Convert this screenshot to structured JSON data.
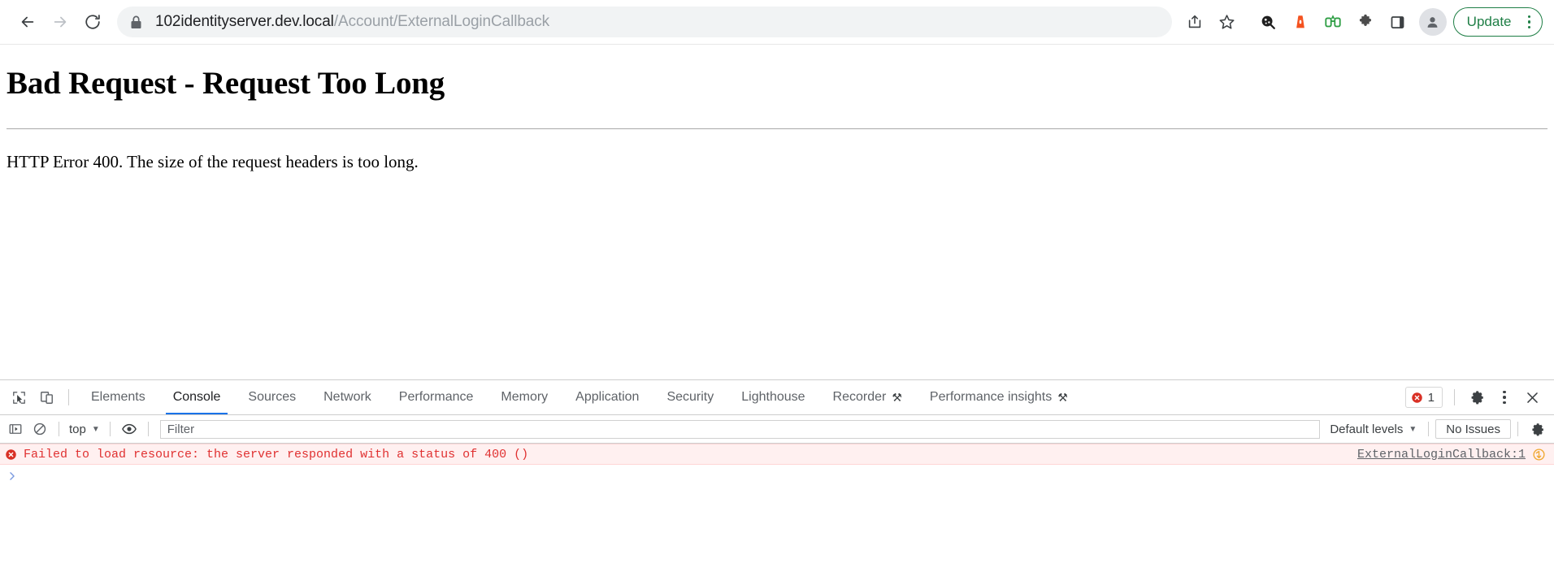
{
  "browser": {
    "back_label": "Back",
    "forward_label": "Forward",
    "reload_label": "Reload",
    "lock_label": "View site information",
    "url_domain": "102identityserver.dev.local",
    "url_path": "/Account/ExternalLoginCallback",
    "share_label": "Share this page",
    "bookmark_label": "Bookmark this tab",
    "extensions": [
      {
        "name": "extension-icon-cookie-editor",
        "color": "#1f1f1f"
      },
      {
        "name": "extension-icon-lighthouse",
        "color": "#f4511e"
      },
      {
        "name": "extension-icon-binoculars",
        "color": "#2e9e44"
      },
      {
        "name": "extensions-puzzle-icon",
        "color": "#4b4b4b"
      }
    ],
    "side_panel_label": "Side panel",
    "profile_label": "Profile",
    "update_label": "Update",
    "menu_label": "Customize and control Google Chrome"
  },
  "page": {
    "title": "Bad Request - Request Too Long",
    "body": "HTTP Error 400. The size of the request headers is too long."
  },
  "devtools": {
    "inspect_label": "Inspect element",
    "device_toggle_label": "Toggle device toolbar",
    "tabs": [
      {
        "label": "Elements",
        "active": false,
        "experimental": false
      },
      {
        "label": "Console",
        "active": true,
        "experimental": false
      },
      {
        "label": "Sources",
        "active": false,
        "experimental": false
      },
      {
        "label": "Network",
        "active": false,
        "experimental": false
      },
      {
        "label": "Performance",
        "active": false,
        "experimental": false
      },
      {
        "label": "Memory",
        "active": false,
        "experimental": false
      },
      {
        "label": "Application",
        "active": false,
        "experimental": false
      },
      {
        "label": "Security",
        "active": false,
        "experimental": false
      },
      {
        "label": "Lighthouse",
        "active": false,
        "experimental": false
      },
      {
        "label": "Recorder",
        "active": false,
        "experimental": true
      },
      {
        "label": "Performance insights",
        "active": false,
        "experimental": true
      }
    ],
    "error_count": "1",
    "settings_label": "Settings",
    "more_label": "More options",
    "close_label": "Close DevTools",
    "console": {
      "sidebar_toggle_label": "Show console sidebar",
      "clear_label": "Clear console",
      "context": "top",
      "live_expression_label": "Create live expression",
      "filter_placeholder": "Filter",
      "filter_value": "",
      "levels": "Default levels",
      "issues": "No Issues",
      "console_settings_label": "Console settings",
      "messages": [
        {
          "text": "Failed to load resource: the server responded with a status of 400 ()",
          "source": "ExternalLoginCallback:1",
          "level": "error"
        }
      ],
      "prompt": ">"
    }
  },
  "colors": {
    "accent_blue": "#1a73e8",
    "error_red": "#e03131",
    "error_bg": "#fff0f0",
    "update_green": "#1e7e45"
  }
}
